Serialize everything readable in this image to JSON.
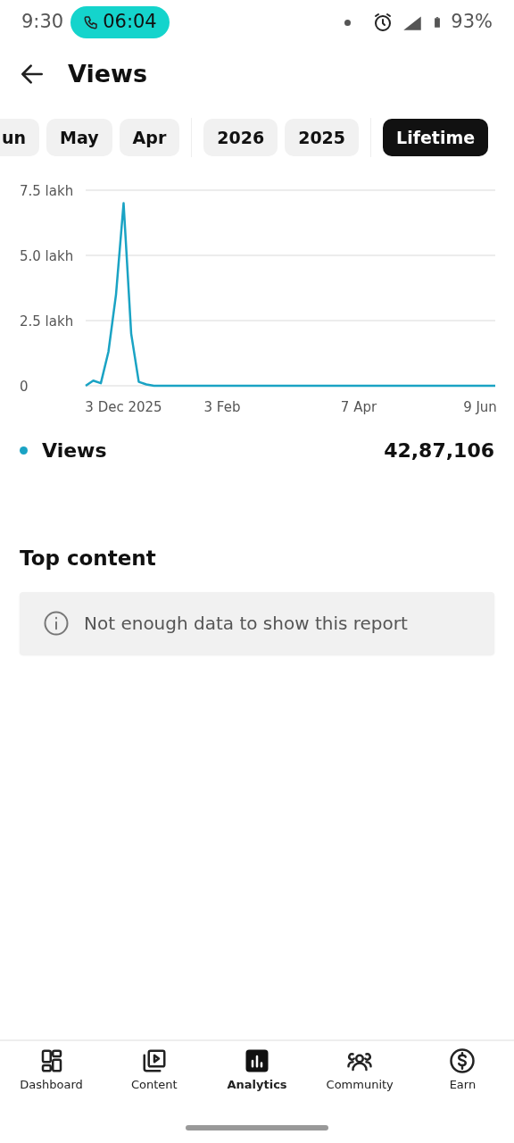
{
  "status_bar": {
    "time": "9:30",
    "call_timer": "06:04",
    "battery": "93%"
  },
  "header": {
    "title": "Views"
  },
  "filters": [
    {
      "label": "un",
      "selected": false
    },
    {
      "label": "May",
      "selected": false
    },
    {
      "label": "Apr",
      "selected": false
    },
    {
      "label": "2026",
      "selected": false
    },
    {
      "label": "2025",
      "selected": false
    },
    {
      "label": "Lifetime",
      "selected": true
    }
  ],
  "chart_data": {
    "type": "line",
    "categories": [
      null,
      null,
      null,
      null,
      null,
      "3 Dec 2025",
      null,
      null,
      null,
      null,
      null,
      null,
      null,
      null,
      null,
      null,
      null,
      null,
      "3 Feb",
      null,
      null,
      null,
      null,
      null,
      null,
      null,
      null,
      null,
      null,
      null,
      null,
      null,
      null,
      null,
      null,
      null,
      "7 Apr",
      null,
      null,
      null,
      null,
      null,
      null,
      null,
      null,
      null,
      null,
      null,
      null,
      null,
      null,
      null,
      "9 Jun",
      null,
      null
    ],
    "yticks": [
      {
        "value": 0,
        "label": "0"
      },
      {
        "value": 2.5,
        "label": "2.5 lakh"
      },
      {
        "value": 5,
        "label": "5.0 lakh"
      },
      {
        "value": 7.5,
        "label": "7.5 lakh"
      }
    ],
    "ylim": [
      0,
      7.5
    ],
    "series": [
      {
        "name": "Views",
        "color": "#1aa3c4",
        "values": [
          0,
          0.2,
          0.1,
          1.3,
          3.5,
          7.0,
          2.0,
          0.15,
          0.05,
          0,
          0,
          0,
          0,
          0,
          0,
          0,
          0,
          0,
          0,
          0,
          0,
          0,
          0,
          0,
          0,
          0,
          0,
          0,
          0,
          0,
          0,
          0,
          0,
          0,
          0,
          0,
          0,
          0,
          0,
          0,
          0,
          0,
          0,
          0,
          0,
          0,
          0,
          0,
          0,
          0,
          0,
          0,
          0,
          0,
          0
        ]
      }
    ]
  },
  "legend": {
    "total": "42,87,106"
  },
  "top_content": {
    "title": "Top content",
    "message": "Not enough data to show this report"
  },
  "bottom_nav": [
    {
      "label": "Dashboard",
      "selected": false
    },
    {
      "label": "Content",
      "selected": false
    },
    {
      "label": "Analytics",
      "selected": true
    },
    {
      "label": "Community",
      "selected": false
    },
    {
      "label": "Earn",
      "selected": false
    }
  ]
}
